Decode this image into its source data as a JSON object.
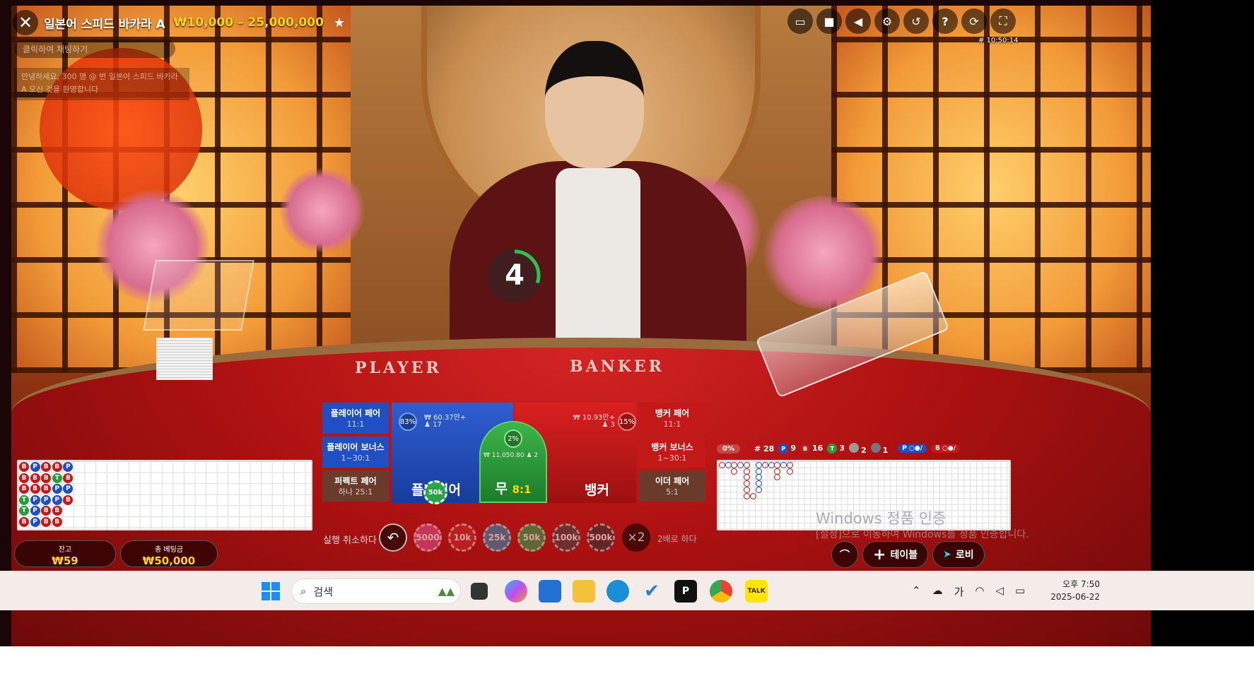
{
  "header": {
    "title": "일본어 스피드 바카라 A",
    "limits": "₩10,000 – 25,000,000",
    "round_id": "# 10:50:14"
  },
  "chat": {
    "placeholder": "클릭하여 채팅하기",
    "message": "안녕하세요, 300 명 @ 번 일본어 스피드 바카라 A 오신 것을 환영합니다"
  },
  "toolbar": {
    "icons": [
      "chat-icon",
      "video-icon",
      "sound-icon",
      "settings-icon",
      "history-icon",
      "help-icon",
      "game-switch-icon",
      "fullscreen-icon"
    ]
  },
  "timer": {
    "value": "4",
    "progress": 0.3
  },
  "table_text": {
    "player": "PLAYER",
    "banker": "BANKER"
  },
  "bets": {
    "player_pair": {
      "label": "플레이어 페어",
      "odds": "11:1"
    },
    "player_bonus": {
      "label": "플레이어 보너스",
      "odds": "1~30:1"
    },
    "perfect_pair": {
      "label": "퍼펙트 페어",
      "odds": "하나 25:1"
    },
    "banker_pair": {
      "label": "뱅커 페어",
      "odds": "11:1"
    },
    "banker_bonus": {
      "label": "뱅커 보너스",
      "odds": "1~30:1"
    },
    "either_pair": {
      "label": "이더 페어",
      "odds": "5:1"
    },
    "player": {
      "label": "플레이어",
      "pct": "83%",
      "amount": "₩ 60.37만+",
      "players": "17",
      "chip": "50k"
    },
    "tie": {
      "label": "무",
      "odds": "8:1",
      "pct": "2%",
      "amount": "₩ 11,050.80",
      "players": "2"
    },
    "banker": {
      "label": "뱅커",
      "pct": "15%",
      "amount": "₩ 10.93만+",
      "players": "3"
    }
  },
  "controls": {
    "undo": "실행 취소하다",
    "double": "2배로 하다",
    "double_icon": "×2",
    "chips": [
      {
        "label": "5000",
        "color": "#d44f8a"
      },
      {
        "label": "10k",
        "color": "#c12c2c"
      },
      {
        "label": "25k",
        "color": "#2a8ab0"
      },
      {
        "label": "50k",
        "color": "#2aa44a"
      },
      {
        "label": "100k",
        "color": "#444444"
      },
      {
        "label": "500k",
        "color": "#333333"
      }
    ]
  },
  "bead_road": [
    [
      "B",
      "P",
      "B",
      "B",
      "P"
    ],
    [
      "B",
      "B",
      "B",
      "T",
      "B"
    ],
    [
      "B",
      "B",
      "B",
      "P",
      "P"
    ],
    [
      "T",
      "P",
      "P",
      "P",
      "B"
    ],
    [
      "T",
      "P",
      "B",
      "B"
    ],
    [
      "B",
      "P",
      "B",
      "B"
    ]
  ],
  "wallet": {
    "balance_label": "잔고",
    "balance": "₩59",
    "bet_label": "총 베팅금",
    "bet": "₩50,000"
  },
  "stats": {
    "pct": "0%",
    "round": "# 28",
    "player": "9",
    "banker": "16",
    "tie": "3",
    "player_pair": "2",
    "banker_pair": "1",
    "pred_player": "P",
    "pred_banker": "B"
  },
  "right_buttons": {
    "table": "테이블",
    "lobby": "로비"
  },
  "watermark": {
    "line1": "Windows 정품 인증",
    "line2": "[설정]으로 이동하여 Windows를 정품 인증합니다."
  },
  "taskbar": {
    "search": "검색",
    "ime": "가",
    "time": "오후 7:50",
    "date": "2025-06-22"
  },
  "colors": {
    "player": "#1f4fc2",
    "banker": "#c31919",
    "tie": "#2a9c3a",
    "gold": "#ffd21e"
  }
}
